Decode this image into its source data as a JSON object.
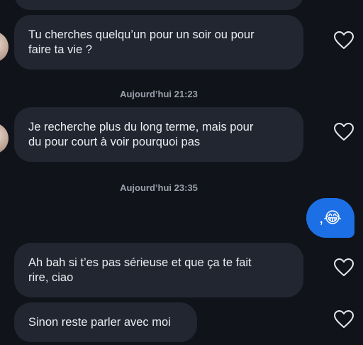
{
  "messages": {
    "msg1": {
      "text": "Tu cherches quelqu’un pour un soir ou pour\nfaire ta vie ?"
    },
    "msg2": {
      "text": "Je recherche plus du long terme, mais pour\ndu pour court à voir pourquoi pas"
    },
    "msg3": {
      "text": ",😂"
    },
    "msg4": {
      "text": "Ah bah si t’es pas sérieuse et que ça te fait\nrire, ciao"
    },
    "msg5": {
      "text": "Sinon reste parler avec moi"
    }
  },
  "timestamps": {
    "t1": "Aujourd’hui 21:23",
    "t2": "Aujourd’hui 23:35"
  },
  "icons": {
    "like": "heart-outline-icon",
    "avatar": "contact-avatar"
  },
  "colors": {
    "background": "#10131a",
    "incoming_bubble": "#222630",
    "outgoing_bubble": "#1d6fe6",
    "timestamp_text": "#9aa0ab"
  }
}
